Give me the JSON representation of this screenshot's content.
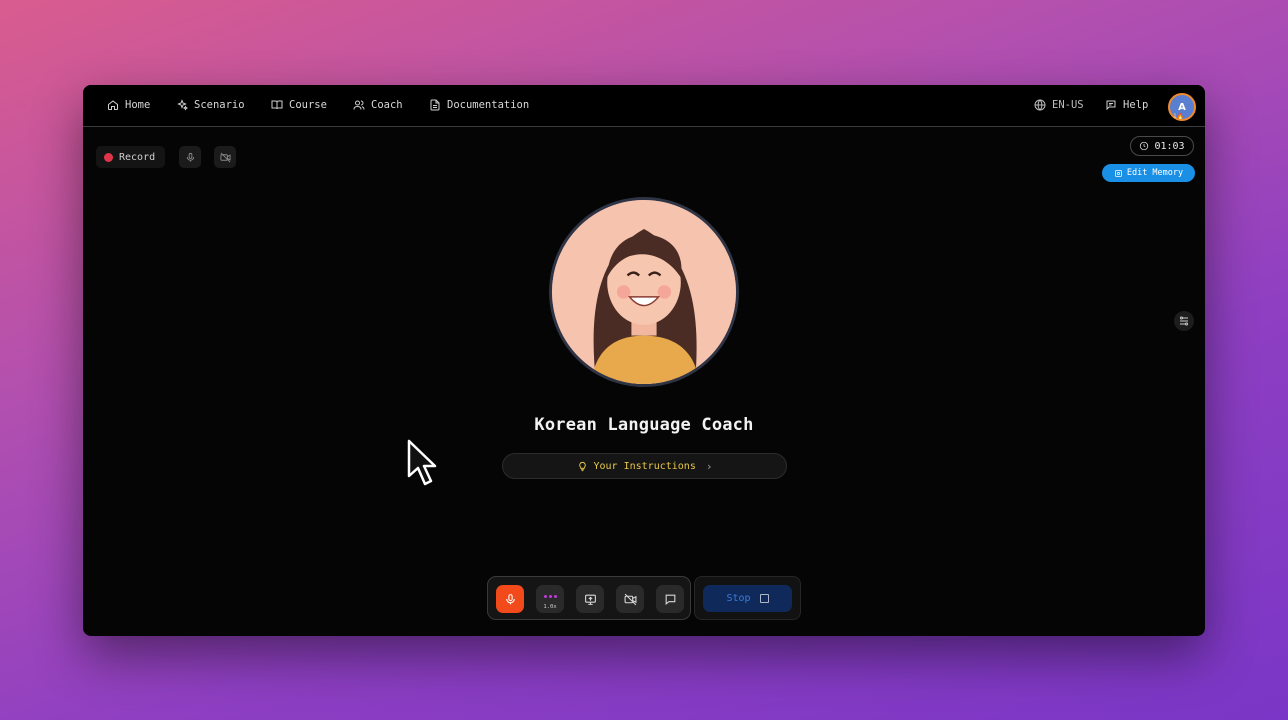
{
  "nav": {
    "items": [
      {
        "label": "Home",
        "icon": "home-icon"
      },
      {
        "label": "Scenario",
        "icon": "sparkles-icon"
      },
      {
        "label": "Course",
        "icon": "book-icon"
      },
      {
        "label": "Coach",
        "icon": "users-icon"
      },
      {
        "label": "Documentation",
        "icon": "document-icon"
      }
    ],
    "language": "EN-US",
    "help": "Help",
    "avatar_initial": "A",
    "avatar_badge": "1🔥"
  },
  "session": {
    "record_label": "Record",
    "timer": "01:03",
    "edit_memory_label": "Edit Memory"
  },
  "coach": {
    "name": "Korean Language Coach",
    "instructions_label": "Your Instructions",
    "instructions_chevron": "›"
  },
  "controls": {
    "speed_label": "1.0x",
    "stop_label": "Stop"
  },
  "colors": {
    "accent_blue": "#1a8fe6",
    "mic_orange": "#f24a1a",
    "record_red": "#e0344a",
    "instructions_yellow": "#e6c74a",
    "stop_bg": "#0f2a5a"
  }
}
